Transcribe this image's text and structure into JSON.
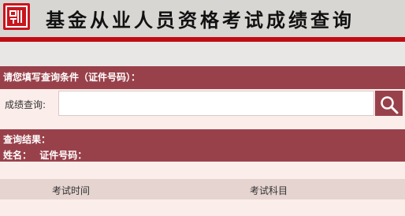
{
  "header": {
    "logo_icon": "red-seal-logo-icon",
    "title": "基金从业人员资格考试成绩查询"
  },
  "query": {
    "section_title": "请您填写查询条件（证件号码）：",
    "label": "成绩查询:",
    "input_value": "",
    "input_placeholder": "",
    "search_icon": "magnifier-icon"
  },
  "results": {
    "section_title": "查询结果：",
    "name_label": "姓名：",
    "id_label": "证件号码："
  },
  "table": {
    "columns": [
      "考试时间",
      "考试科目"
    ]
  },
  "colors": {
    "accent": "#99414a",
    "red_rule": "#c00d14",
    "background": "#fbeeea"
  }
}
